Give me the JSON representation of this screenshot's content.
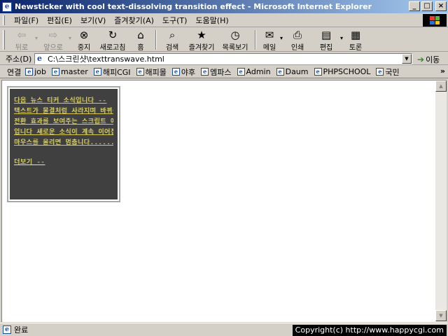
{
  "window": {
    "title": "Newsticker with cool text-dissolving transition effect - Microsoft Internet Explorer",
    "minimize": "_",
    "maximize": "□",
    "close": "×"
  },
  "menu": {
    "items": [
      "파일(F)",
      "편집(E)",
      "보기(V)",
      "즐겨찾기(A)",
      "도구(T)",
      "도움말(H)"
    ]
  },
  "toolbar": {
    "back": "뒤로",
    "forward": "앞으로",
    "stop": "중지",
    "refresh": "새로고침",
    "home": "홈",
    "search": "검색",
    "favorites": "즐겨찾기",
    "history": "목록보기",
    "mail": "메일",
    "print": "인쇄",
    "edit": "편집",
    "discuss": "토론"
  },
  "address": {
    "label": "주소(D)",
    "value": "C:\\스크린샷\\texttranswave.html",
    "go": "이동"
  },
  "links": {
    "label": "연결",
    "items": [
      "job",
      "master",
      "해피CGI",
      "해피몰",
      "야후",
      "엠파스",
      "Admin",
      "Daum",
      "PHPSCHOOL",
      "국민"
    ],
    "more": "»"
  },
  "ticker": {
    "lines": [
      "다음 뉴스 티커 소식입니다 --",
      "텍스트가 물결처럼 사라지며 바뀌는",
      "전환 효과를 보여주는 스크립트 예제",
      "입니다 새로운 소식이 계속 이어집니다",
      "마우스를 올리면 멈춥니다......"
    ],
    "more": "더보기 --"
  },
  "status": {
    "text": "완료",
    "copyright": "Copyright(c) http://www.happycgi.com"
  },
  "colors": {
    "title_start": "#0a246a",
    "title_end": "#a6caf0",
    "chrome": "#d4d0c8",
    "ticker_bg": "#404040",
    "ticker_text": "#f0e87a"
  }
}
